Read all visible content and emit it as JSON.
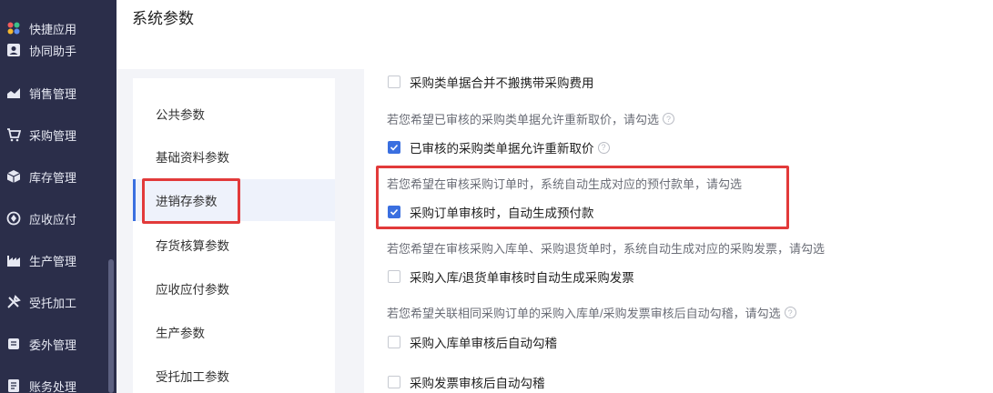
{
  "sidebar": {
    "items": [
      {
        "label": "快捷应用",
        "icon": "apps-icon"
      },
      {
        "label": "协同助手",
        "icon": "contact-card-icon"
      },
      {
        "label": "销售管理",
        "icon": "sales-chart-icon"
      },
      {
        "label": "采购管理",
        "icon": "cart-icon"
      },
      {
        "label": "库存管理",
        "icon": "box-icon"
      },
      {
        "label": "应收应付",
        "icon": "payment-icon"
      },
      {
        "label": "生产管理",
        "icon": "factory-icon"
      },
      {
        "label": "受托加工",
        "icon": "tools-icon"
      },
      {
        "label": "委外管理",
        "icon": "outsource-icon"
      },
      {
        "label": "账务处理",
        "icon": "ledger-icon"
      }
    ]
  },
  "header": {
    "title": "系统参数"
  },
  "nav": {
    "items": [
      {
        "label": "公共参数"
      },
      {
        "label": "基础资料参数"
      },
      {
        "label": "进销存参数"
      },
      {
        "label": "存货核算参数"
      },
      {
        "label": "应收应付参数"
      },
      {
        "label": "生产参数"
      },
      {
        "label": "受托加工参数"
      }
    ],
    "active_index": 2
  },
  "content": {
    "top_partial_label": "采购类单据合并不搬携带采购费用",
    "sections": [
      {
        "desc": "若您希望已审核的采购类单据允许重新取价，请勾选",
        "desc_help": true,
        "option": "已审核的采购类单据允许重新取价",
        "option_help": true,
        "checked": true
      },
      {
        "desc": "若您希望在审核采购订单时，系统自动生成对应的预付款单，请勾选",
        "desc_help": false,
        "option": "采购订单审核时，自动生成预付款",
        "option_help": false,
        "checked": true
      },
      {
        "desc": "若您希望在审核采购入库单、采购退货单时，系统自动生成对应的采购发票，请勾选",
        "desc_help": false,
        "option": "采购入库/退货单审核时自动生成采购发票",
        "option_help": false,
        "checked": false
      },
      {
        "desc": "若您希望关联相同采购订单的采购入库单/采购发票审核后自动勾稽，请勾选",
        "desc_help": true,
        "option": "采购入库单审核后自动勾稽",
        "option_help": false,
        "checked": false
      }
    ],
    "extra_option": {
      "label": "采购发票审核后自动勾稽",
      "checked": false
    }
  },
  "colors": {
    "accent": "#3a6fe0",
    "highlight": "#e23a3a",
    "sidebar": "#2b2e4a"
  }
}
